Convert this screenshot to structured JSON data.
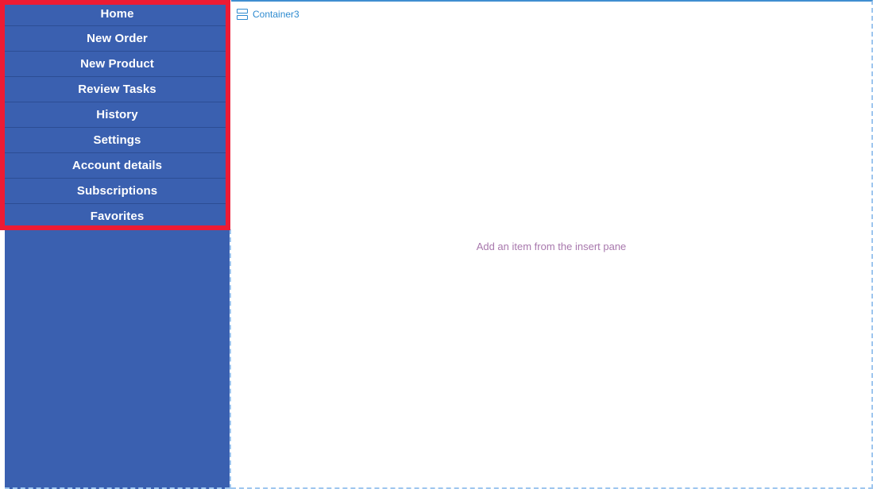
{
  "sidebar": {
    "name": "main-navigation-menu",
    "background_color": "#3a60b0",
    "separator_color": "#2c4d94",
    "text_color": "#ffffff",
    "items": [
      {
        "label": "Home"
      },
      {
        "label": "New Order"
      },
      {
        "label": "New Product"
      },
      {
        "label": "Review Tasks"
      },
      {
        "label": "History"
      },
      {
        "label": "Settings"
      },
      {
        "label": "Account details"
      },
      {
        "label": "Subscriptions"
      },
      {
        "label": "Favorites"
      }
    ]
  },
  "selection": {
    "color": "#ed1b34",
    "label": "menu-selection-highlight"
  },
  "design_surface": {
    "container": {
      "icon": "split-container-icon",
      "title": "Container3",
      "title_color": "#2e8bd0"
    },
    "empty_state": {
      "message": "Add an item from the insert pane",
      "color": "#a878ad"
    },
    "border_color_solid": "#3f8ed0",
    "border_color_dashed": "#9ec6ef"
  }
}
